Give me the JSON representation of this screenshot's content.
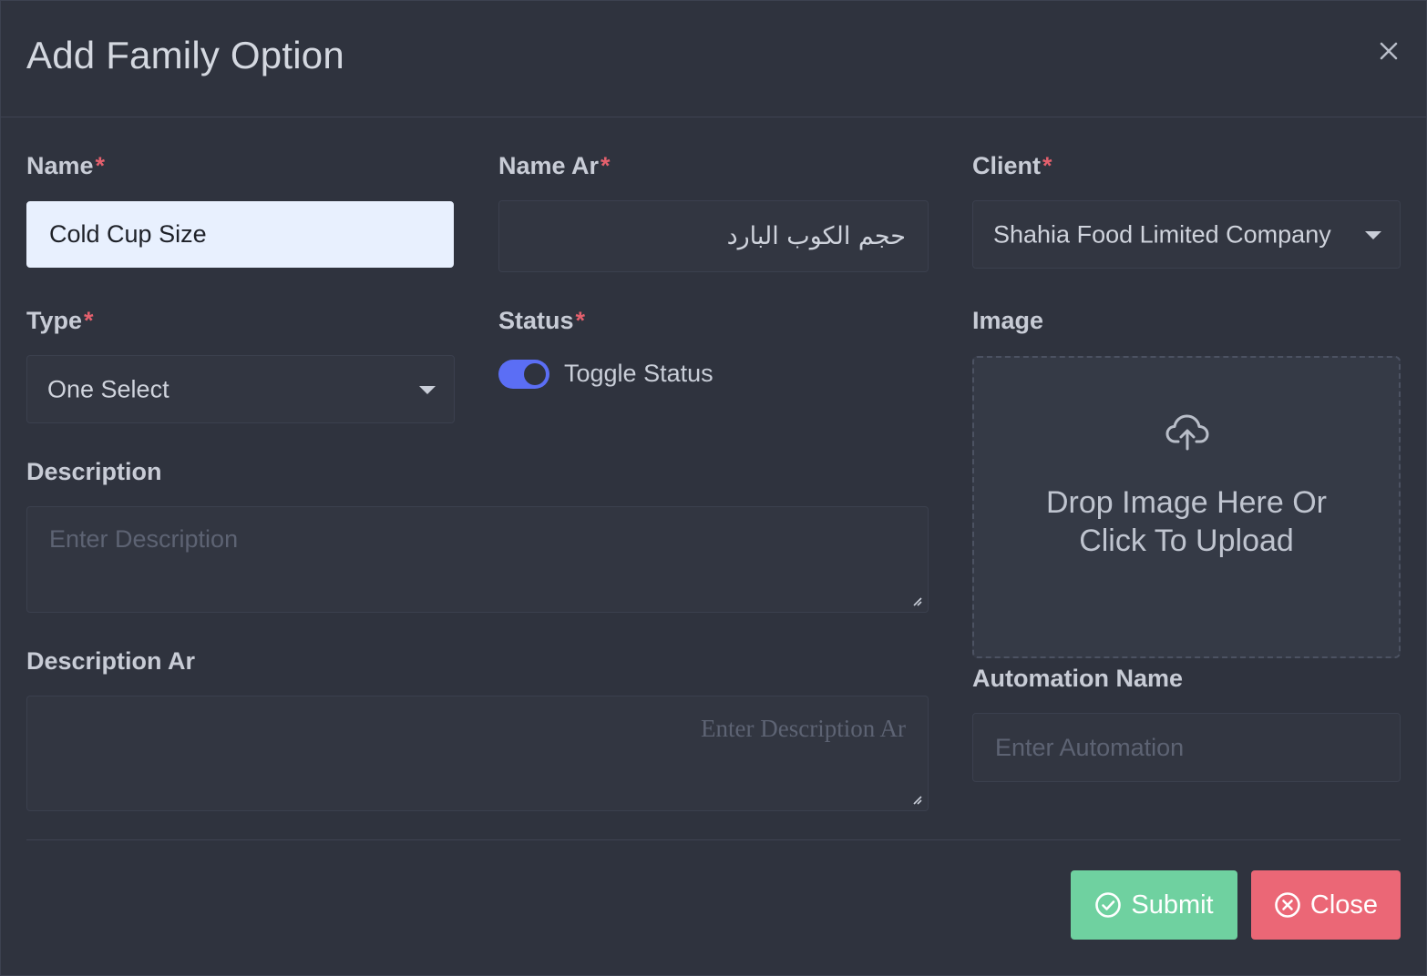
{
  "modal": {
    "title": "Add Family Option",
    "close_icon": "close-x-icon"
  },
  "form": {
    "name": {
      "label": "Name",
      "required": "*",
      "value": "Cold Cup Size"
    },
    "name_ar": {
      "label": "Name Ar",
      "required": "*",
      "value": "حجم الكوب البارد"
    },
    "client": {
      "label": "Client",
      "required": "*",
      "selected": "Shahia Food Limited Company"
    },
    "type": {
      "label": "Type",
      "required": "*",
      "selected": "One Select"
    },
    "status": {
      "label": "Status",
      "required": "*",
      "toggle_label": "Toggle Status",
      "on": true
    },
    "image": {
      "label": "Image",
      "drop_text_line1": "Drop Image Here Or",
      "drop_text_line2": "Click To Upload",
      "icon": "cloud-upload-icon"
    },
    "description": {
      "label": "Description",
      "placeholder": "Enter Description"
    },
    "description_ar": {
      "label": "Description Ar",
      "placeholder": "Enter Description Ar"
    },
    "automation_name": {
      "label": "Automation Name",
      "placeholder": "Enter Automation"
    }
  },
  "footer": {
    "submit_label": "Submit",
    "submit_icon": "check-circle-icon",
    "close_label": "Close",
    "close_icon": "x-circle-icon"
  },
  "colors": {
    "background": "#2f333e",
    "accent": "#5b6ef5",
    "submit": "#6fd1a0",
    "close": "#eb6776",
    "required": "#e4606d"
  }
}
